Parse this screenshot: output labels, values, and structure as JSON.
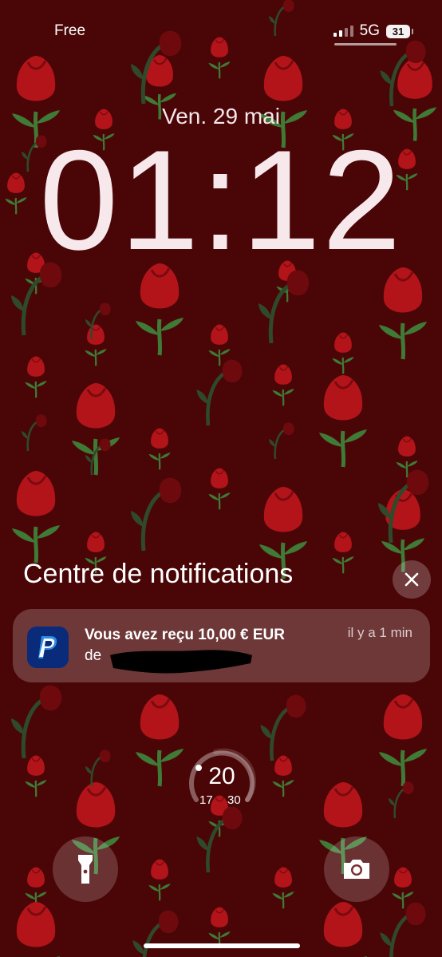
{
  "status_bar": {
    "carrier": "Free",
    "network": "5G",
    "battery": "31"
  },
  "lock_screen": {
    "date": "Ven. 29 mai",
    "time": "01:12"
  },
  "notification_center": {
    "title": "Centre de notifications",
    "notifications": [
      {
        "app_icon": "paypal-icon",
        "title": "Vous avez reçu 10,00 € EUR",
        "body": "de",
        "time": "il y a 1 min"
      }
    ]
  },
  "widget": {
    "value": "20",
    "min": "17",
    "max": "30"
  },
  "icons": {
    "close": "close-icon",
    "flashlight": "flashlight-icon",
    "camera": "camera-icon"
  },
  "colors": {
    "wallpaper": "#4a0607",
    "rose": "#b3141a",
    "leaf": "#3f7a36"
  }
}
